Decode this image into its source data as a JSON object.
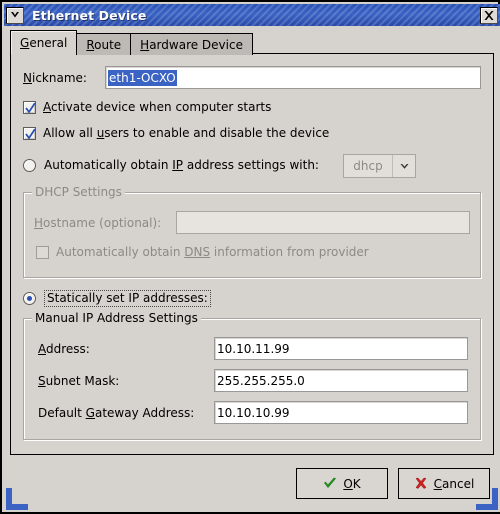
{
  "window": {
    "title": "Ethernet Device",
    "menu_icon": "chevron-down-icon",
    "close_icon": "close-icon"
  },
  "tabs": [
    {
      "label": "General",
      "mnemonic": "G",
      "active": true
    },
    {
      "label": "Route",
      "mnemonic": "R",
      "active": false
    },
    {
      "label": "Hardware Device",
      "mnemonic": "H",
      "active": false
    }
  ],
  "general": {
    "nickname": {
      "label_pre": "",
      "label_mnemonic": "N",
      "label_post": "ickname:",
      "value": "eth1-OCXO",
      "selected": true
    },
    "activate_checkbox": {
      "checked": true,
      "pre": "",
      "mnemonic": "A",
      "post": "ctivate device when computer starts"
    },
    "allow_users_checkbox": {
      "checked": true,
      "pre": "Allow all ",
      "mnemonic": "u",
      "post": "sers to enable and disable the device"
    },
    "auto_radio": {
      "selected": false,
      "pre": "Automatically obtain ",
      "mnemonic": "IP",
      "post": " address settings with:"
    },
    "protocol_combo": {
      "value": "dhcp",
      "arrow_icon": "chevron-down-icon",
      "disabled": true
    },
    "dhcp_group": {
      "title": "DHCP Settings",
      "disabled": true,
      "hostname": {
        "pre": "",
        "mnemonic": "H",
        "post": "ostname (optional):",
        "value": ""
      },
      "dns_checkbox": {
        "checked": false,
        "pre": "Automatically obtain ",
        "mnemonic": "DNS",
        "post": " information from provider"
      }
    },
    "static_radio": {
      "selected": true,
      "focused": true,
      "label": "Statically set IP addresses:"
    },
    "manual_group": {
      "title": "Manual IP Address Settings",
      "fields": [
        {
          "pre": "",
          "mnemonic": "A",
          "post": "ddress:",
          "value": "10.10.11.99"
        },
        {
          "pre": "",
          "mnemonic": "S",
          "post": "ubnet Mask:",
          "value": "255.255.255.0"
        },
        {
          "pre": "Default ",
          "mnemonic": "G",
          "post": "ateway Address:",
          "value": "10.10.10.99"
        }
      ]
    }
  },
  "buttons": {
    "ok": {
      "pre": "",
      "mnemonic": "O",
      "post": "K",
      "icon": "check-icon",
      "icon_color": "#22a022"
    },
    "cancel": {
      "pre": "",
      "mnemonic": "C",
      "post": "ancel",
      "icon": "x-icon",
      "icon_color": "#cc2222"
    }
  },
  "colors": {
    "titlebar_blue": "#2a52b5",
    "face": "#d6d2cd",
    "selection": "#3a63c4",
    "grip": "#3a63c4"
  }
}
